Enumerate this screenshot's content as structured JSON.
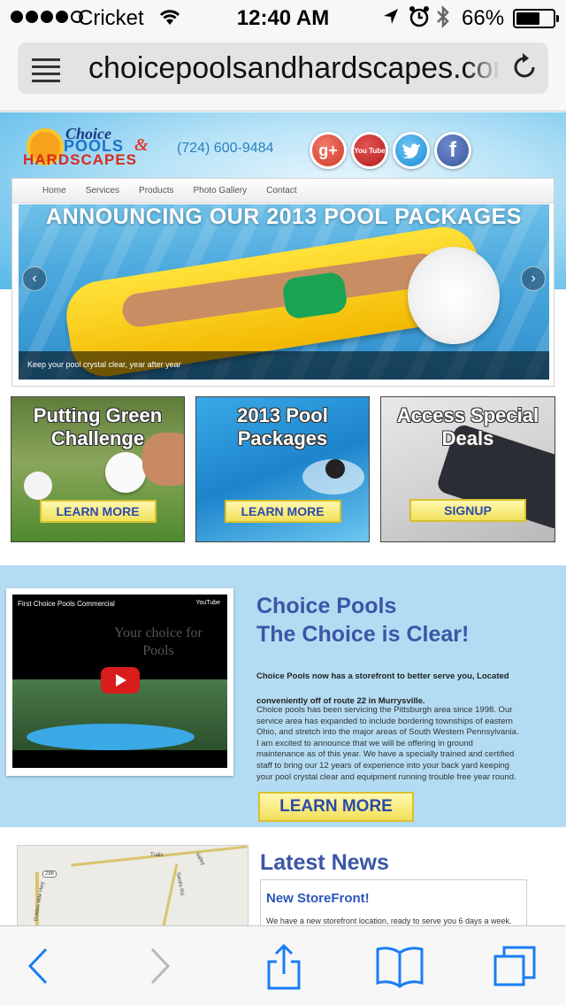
{
  "status_bar": {
    "carrier": "Cricket",
    "time": "12:40 AM",
    "battery": "66%"
  },
  "browser": {
    "url": "choicepoolsandhardscapes.com"
  },
  "site": {
    "logo": {
      "choice": "Choice",
      "pools": "POOLS",
      "amp": "&",
      "hardscapes": "HARDSCAPES"
    },
    "phone": "(724) 600-9484",
    "social": {
      "google": "g+",
      "youtube": "You Tube"
    },
    "nav": [
      "Home",
      "Services",
      "Products",
      "Photo Gallery",
      "Contact"
    ],
    "slider": {
      "title": "ANNOUNCING OUR 2013 POOL PACKAGES",
      "caption": "Keep your pool crystal clear, year after year",
      "prev": "‹",
      "next": "›"
    },
    "promos": [
      {
        "title": "Putting Green Challenge",
        "button": "LEARN MORE"
      },
      {
        "title": "2013 Pool Packages",
        "button": "LEARN MORE"
      },
      {
        "title": "Access Special Deals",
        "button": "SIGNUP"
      }
    ],
    "video": {
      "title": "First Choice Pools Commercial",
      "provider": "YouTube",
      "watermark": "Your choice for Pools"
    },
    "about": {
      "heading1": "Choice Pools",
      "heading2": "The Choice is Clear!",
      "lead": "Choice Pools now has a storefront to better serve you, Located conveniently off of route 22 in Murrysville.",
      "body": "Choice pools has been servicing the Pittsburgh area since 1998. Our service area has expanded to include bordering townships of eastern Ohio, and stretch into the major areas of South Western Pennsylvania. I am excited to announce that we will be offering in ground maintenance as of this year. We have a specially trained and certified staff to bring our 12 years of experience into your back yard keeping your pool crystal clear and equipment running trouble free year round.",
      "button": "LEARN MORE"
    },
    "map": {
      "labels": [
        "Trails",
        "Golden Mile Hwy",
        "Sardis Rd",
        "286",
        "Valley"
      ]
    },
    "news": {
      "heading": "Latest News",
      "item_title": "New StoreFront!",
      "item_text": "We have a new storefront location, ready to serve you 6 days a week."
    }
  },
  "colors": {
    "link_blue": "#3b56a6",
    "button_yellow": "#f2e05a",
    "about_bg": "#b3dcf3",
    "ios_blue": "#1a7ef5"
  }
}
